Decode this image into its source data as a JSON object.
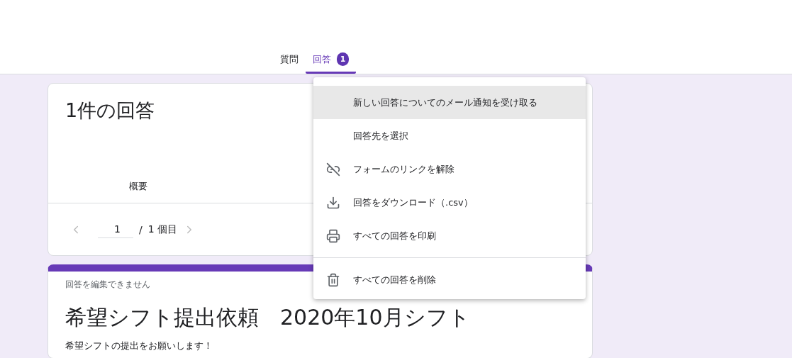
{
  "tabs": [
    {
      "label": "質問",
      "selected": false
    },
    {
      "label": "回答",
      "selected": true,
      "badge": "1"
    }
  ],
  "summary": {
    "title": "1件の回答",
    "view_tabs": [
      "概要"
    ],
    "pager": {
      "value": "1",
      "separator": "/",
      "total": "1 個目"
    }
  },
  "form": {
    "notice": "回答を編集できません",
    "title": "希望シフト提出依頼　2020年10月シフト",
    "description": "希望シフトの提出をお願いします！"
  },
  "menu": {
    "groups": [
      [
        {
          "label": "新しい回答についてのメール通知を受け取る",
          "kind": "plain",
          "highlighted": true
        },
        {
          "label": "回答先を選択",
          "kind": "plain",
          "highlighted": false
        },
        {
          "label": "フォームのリンクを解除",
          "kind": "unlink",
          "highlighted": false
        },
        {
          "label": "回答をダウンロード（.csv）",
          "kind": "download",
          "highlighted": false
        },
        {
          "label": "すべての回答を印刷",
          "kind": "print",
          "highlighted": false
        }
      ],
      [
        {
          "label": "すべての回答を削除",
          "kind": "delete",
          "highlighted": false
        }
      ]
    ]
  }
}
